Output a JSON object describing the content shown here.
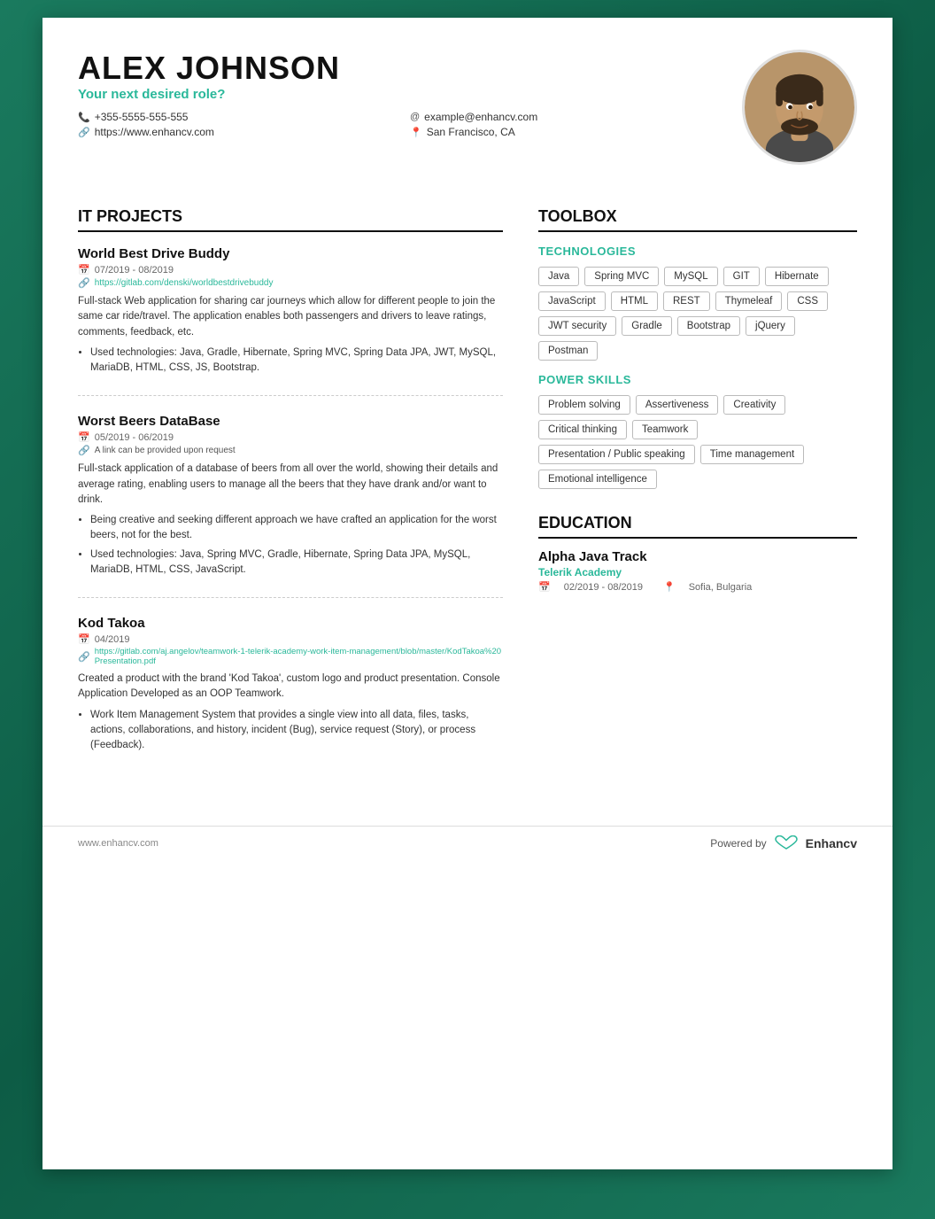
{
  "header": {
    "name": "ALEX JOHNSON",
    "role": "Your next desired role?",
    "phone": "+355-5555-555-555",
    "website": "https://www.enhancv.com",
    "email": "example@enhancv.com",
    "location": "San Francisco, CA"
  },
  "it_projects": {
    "title": "IT PROJECTS",
    "projects": [
      {
        "title": "World Best Drive Buddy",
        "date": "07/2019 - 08/2019",
        "link": "https://gitlab.com/denski/worldbestdrivebuddy",
        "desc": "Full-stack Web application for sharing car journeys which allow for different people to join the same car ride/travel. The application enables both passengers and drivers to leave ratings, comments, feedback, etc.",
        "bullets": [
          "Used technologies: Java, Gradle, Hibernate, Spring MVC, Spring Data JPA, JWT, MySQL, MariaDB, HTML, CSS, JS, Bootstrap."
        ]
      },
      {
        "title": "Worst Beers DataBase",
        "date": "05/2019 - 06/2019",
        "link": "A link can be provided upon request",
        "desc": "Full-stack application of a database of beers from all over the world, showing their details and average rating, enabling users to manage all the beers that they have drank and/or want to drink.",
        "bullets": [
          "Being creative and seeking different approach we have crafted an application for the worst beers, not for the best.",
          "Used technologies: Java, Spring MVC, Gradle, Hibernate, Spring Data JPA, MySQL, MariaDB, HTML, CSS, JavaScript."
        ]
      },
      {
        "title": "Kod Takoa",
        "date": "04/2019",
        "link": "https://gitlab.com/aj.angelov/teamwork-1-telerik-academy-work-item-management/blob/master/KodTakoa%20Presentation.pdf",
        "desc": "Created a product with the brand 'Kod Takoa', custom logo and product presentation. Console Application Developed as an OOP Teamwork.",
        "bullets": [
          "Work Item Management System that provides a single view into all data, files, tasks, actions, collaborations, and history, incident (Bug), service request (Story), or process (Feedback)."
        ]
      }
    ]
  },
  "toolbox": {
    "title": "TOOLBOX",
    "technologies": {
      "subtitle": "TECHNOLOGIES",
      "tags": [
        "Java",
        "Spring MVC",
        "MySQL",
        "GIT",
        "Hibernate",
        "JavaScript",
        "HTML",
        "REST",
        "Thymeleaf",
        "CSS",
        "JWT security",
        "Gradle",
        "Bootstrap",
        "jQuery",
        "Postman"
      ]
    },
    "power_skills": {
      "subtitle": "POWER SKILLS",
      "tags": [
        "Problem solving",
        "Assertiveness",
        "Creativity",
        "Critical thinking",
        "Teamwork",
        "Presentation / Public speaking",
        "Time management",
        "Emotional intelligence"
      ]
    }
  },
  "education": {
    "title": "EDUCATION",
    "items": [
      {
        "degree": "Alpha Java Track",
        "school": "Telerik Academy",
        "date": "02/2019 - 08/2019",
        "location": "Sofia, Bulgaria"
      }
    ]
  },
  "footer": {
    "website": "www.enhancv.com",
    "powered_by": "Powered by",
    "brand": "Enhancv"
  }
}
